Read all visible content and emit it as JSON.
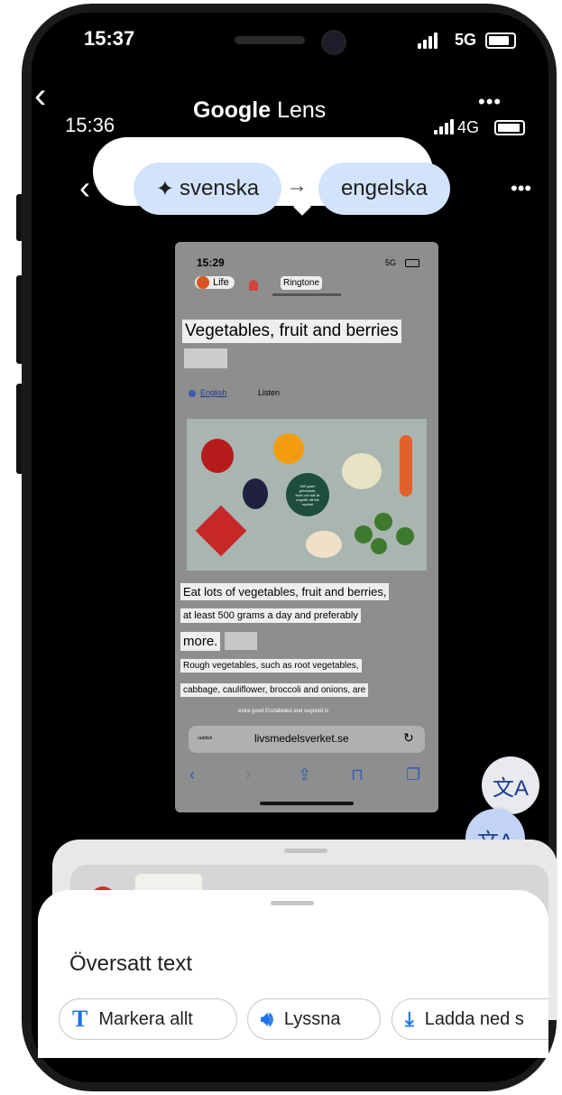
{
  "status_bar": {
    "time": "15:37",
    "network": "5G"
  },
  "lens_header": {
    "inner_time": "15:36",
    "title_brand": "Google",
    "title_product": "Lens",
    "inner_network": "4G"
  },
  "language_selector": {
    "source_language": "svenska",
    "arrow": "→",
    "target_language": "engelska"
  },
  "captured_page": {
    "time": "15:29",
    "network": "5G",
    "tab_label": "Life",
    "popup_label": "Ringtone",
    "heading": "Vegetables, fruit and berries",
    "language_link": "English",
    "listen_label": "Listen",
    "center_label_lines": [
      "500 gram",
      "grönsaker,",
      "frukt och bär är",
      "ungefär så här",
      "mycket"
    ],
    "paragraph_lines": [
      "Eat lots of vegetables, fruit and berries,",
      "at least 500 grams a day and preferably",
      "more.",
      "Rough vegetables, such as root vegetables,",
      "cabbage, cauliflower, broccoli and onions, are",
      "extra good Ecolabeled and sugnold is"
    ],
    "url": "livsmedelsverket.se",
    "url_left": "raddish"
  },
  "sheet": {
    "title": "Översatt text",
    "buttons": [
      {
        "icon": "text-icon",
        "label": "Markera allt"
      },
      {
        "icon": "speaker-icon",
        "label": "Lyssna"
      },
      {
        "icon": "download-icon",
        "label": "Ladda ned s"
      }
    ]
  },
  "colors": {
    "chip": "#d3e3fd",
    "accent": "#1a73e8",
    "fab": "#c2d3f5"
  }
}
